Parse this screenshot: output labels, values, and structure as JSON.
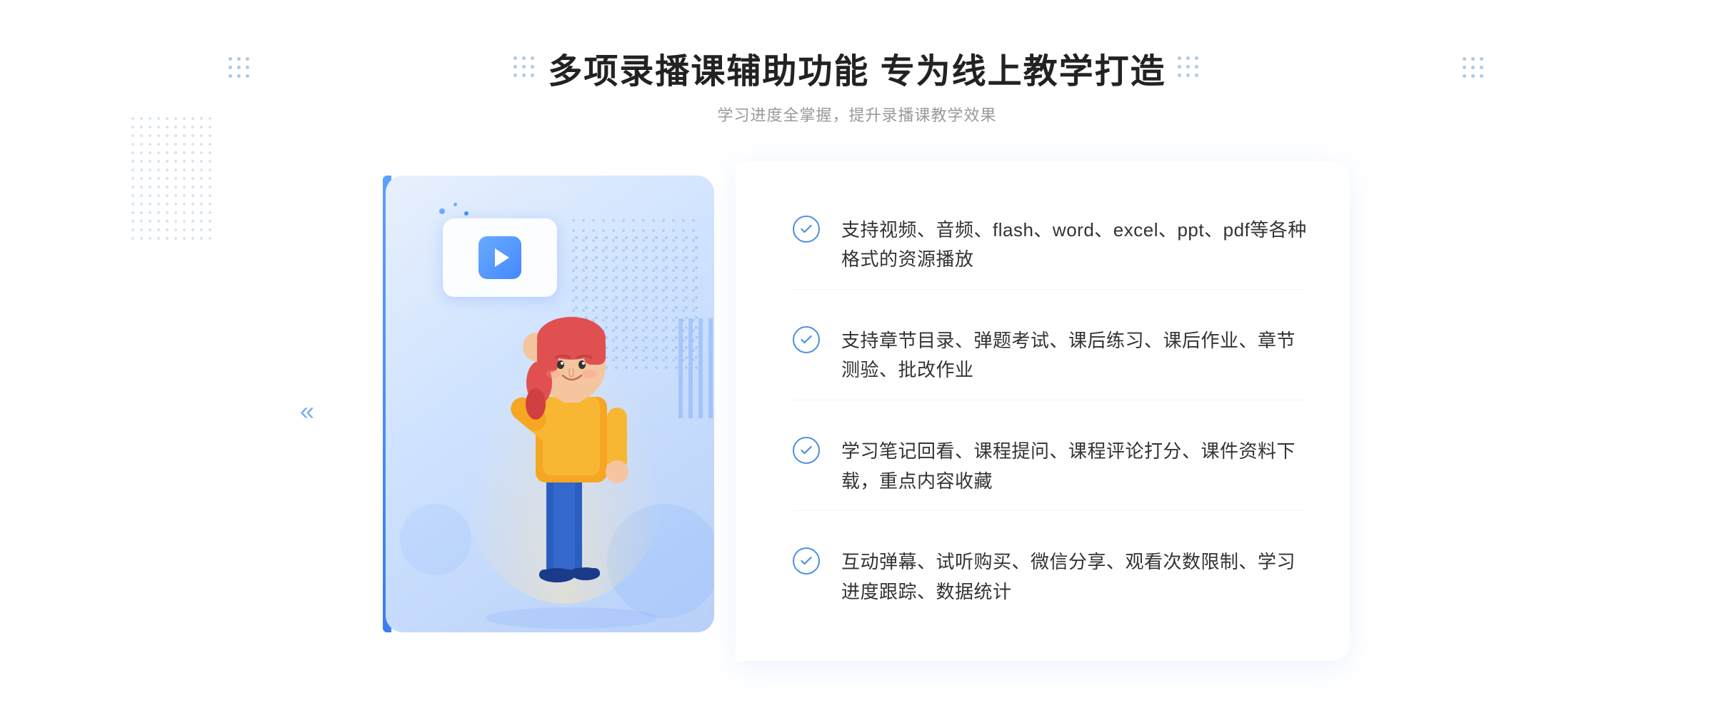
{
  "header": {
    "main_title": "多项录播课辅助功能 专为线上教学打造",
    "sub_title": "学习进度全掌握，提升录播课教学效果"
  },
  "features": [
    {
      "id": 1,
      "text": "支持视频、音频、flash、word、excel、ppt、pdf等各种格式的资源播放"
    },
    {
      "id": 2,
      "text": "支持章节目录、弹题考试、课后练习、课后作业、章节测验、批改作业"
    },
    {
      "id": 3,
      "text": "学习笔记回看、课程提问、课程评论打分、课件资料下载，重点内容收藏"
    },
    {
      "id": 4,
      "text": "互动弹幕、试听购买、微信分享、观看次数限制、学习进度跟踪、数据统计"
    }
  ],
  "decorations": {
    "chevron_left": "«",
    "chevron_right": "»"
  }
}
